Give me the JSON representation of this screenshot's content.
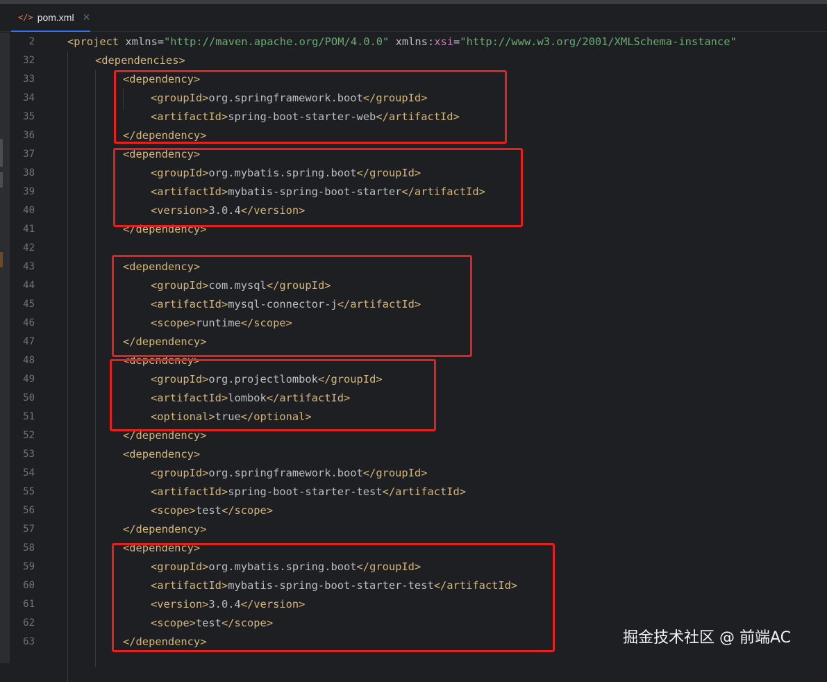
{
  "tab": {
    "icon": "</>",
    "label": "pom.xml",
    "close": "×"
  },
  "lines": [
    {
      "num": "2",
      "indent": 0,
      "parts": [
        [
          "tag",
          "<project "
        ],
        [
          "attr",
          "xmlns="
        ],
        [
          "str",
          "\"http://maven.apache.org/POM/4.0.0\""
        ],
        [
          "attr",
          " xmlns:"
        ],
        [
          "ns",
          "xsi"
        ],
        [
          "attr",
          "="
        ],
        [
          "str",
          "\"http://www.w3.org/2001/XMLSchema-instance\""
        ]
      ]
    },
    {
      "num": "32",
      "indent": 1,
      "parts": [
        [
          "tag",
          "<dependencies>"
        ]
      ]
    },
    {
      "num": "33",
      "indent": 2,
      "parts": [
        [
          "tag",
          "<dependency>"
        ]
      ]
    },
    {
      "num": "34",
      "indent": 3,
      "parts": [
        [
          "tag",
          "<groupId>"
        ],
        [
          "txt",
          "org.springframework.boot"
        ],
        [
          "tag",
          "</groupId>"
        ]
      ]
    },
    {
      "num": "35",
      "indent": 3,
      "parts": [
        [
          "tag",
          "<artifactId>"
        ],
        [
          "txt",
          "spring-boot-starter-web"
        ],
        [
          "tag",
          "</artifactId>"
        ]
      ]
    },
    {
      "num": "36",
      "indent": 2,
      "parts": [
        [
          "tag",
          "</dependency>"
        ]
      ]
    },
    {
      "num": "37",
      "indent": 2,
      "parts": [
        [
          "tag",
          "<dependency>"
        ]
      ]
    },
    {
      "num": "38",
      "indent": 3,
      "parts": [
        [
          "tag",
          "<groupId>"
        ],
        [
          "txt",
          "org.mybatis.spring.boot"
        ],
        [
          "tag",
          "</groupId>"
        ]
      ]
    },
    {
      "num": "39",
      "indent": 3,
      "parts": [
        [
          "tag",
          "<artifactId>"
        ],
        [
          "txt",
          "mybatis-spring-boot-starter"
        ],
        [
          "tag",
          "</artifactId>"
        ]
      ]
    },
    {
      "num": "40",
      "indent": 3,
      "parts": [
        [
          "tag",
          "<version>"
        ],
        [
          "txt",
          "3.0.4"
        ],
        [
          "tag",
          "</version>"
        ]
      ]
    },
    {
      "num": "41",
      "indent": 2,
      "parts": [
        [
          "tag",
          "</dependency>"
        ]
      ]
    },
    {
      "num": "42",
      "indent": 0,
      "parts": []
    },
    {
      "num": "43",
      "indent": 2,
      "parts": [
        [
          "tag",
          "<dependency>"
        ]
      ]
    },
    {
      "num": "44",
      "indent": 3,
      "parts": [
        [
          "tag",
          "<groupId>"
        ],
        [
          "txt",
          "com.mysql"
        ],
        [
          "tag",
          "</groupId>"
        ]
      ]
    },
    {
      "num": "45",
      "indent": 3,
      "parts": [
        [
          "tag",
          "<artifactId>"
        ],
        [
          "txt",
          "mysql-connector-j"
        ],
        [
          "tag",
          "</artifactId>"
        ]
      ]
    },
    {
      "num": "46",
      "indent": 3,
      "parts": [
        [
          "tag",
          "<scope>"
        ],
        [
          "txt",
          "runtime"
        ],
        [
          "tag",
          "</scope>"
        ]
      ]
    },
    {
      "num": "47",
      "indent": 2,
      "parts": [
        [
          "tag",
          "</dependency>"
        ]
      ]
    },
    {
      "num": "48",
      "indent": 2,
      "parts": [
        [
          "tag",
          "<dependency>"
        ]
      ]
    },
    {
      "num": "49",
      "indent": 3,
      "parts": [
        [
          "tag",
          "<groupId>"
        ],
        [
          "txt",
          "org.projectlombok"
        ],
        [
          "tag",
          "</groupId>"
        ]
      ]
    },
    {
      "num": "50",
      "indent": 3,
      "parts": [
        [
          "tag",
          "<artifactId>"
        ],
        [
          "txt",
          "lombok"
        ],
        [
          "tag",
          "</artifactId>"
        ]
      ]
    },
    {
      "num": "51",
      "indent": 3,
      "parts": [
        [
          "tag",
          "<optional>"
        ],
        [
          "txt",
          "true"
        ],
        [
          "tag",
          "</optional>"
        ]
      ]
    },
    {
      "num": "52",
      "indent": 2,
      "parts": [
        [
          "tag",
          "</dependency>"
        ]
      ]
    },
    {
      "num": "53",
      "indent": 2,
      "parts": [
        [
          "tag",
          "<dependency>"
        ]
      ]
    },
    {
      "num": "54",
      "indent": 3,
      "parts": [
        [
          "tag",
          "<groupId>"
        ],
        [
          "txt",
          "org.springframework.boot"
        ],
        [
          "tag",
          "</groupId>"
        ]
      ]
    },
    {
      "num": "55",
      "indent": 3,
      "parts": [
        [
          "tag",
          "<artifactId>"
        ],
        [
          "txt",
          "spring-boot-starter-test"
        ],
        [
          "tag",
          "</artifactId>"
        ]
      ]
    },
    {
      "num": "56",
      "indent": 3,
      "parts": [
        [
          "tag",
          "<scope>"
        ],
        [
          "txt",
          "test"
        ],
        [
          "tag",
          "</scope>"
        ]
      ]
    },
    {
      "num": "57",
      "indent": 2,
      "parts": [
        [
          "tag",
          "</dependency>"
        ]
      ]
    },
    {
      "num": "58",
      "indent": 2,
      "parts": [
        [
          "tag",
          "<dependency>"
        ]
      ]
    },
    {
      "num": "59",
      "indent": 3,
      "parts": [
        [
          "tag",
          "<groupId>"
        ],
        [
          "txt",
          "org.mybatis.spring.boot"
        ],
        [
          "tag",
          "</groupId>"
        ]
      ]
    },
    {
      "num": "60",
      "indent": 3,
      "parts": [
        [
          "tag",
          "<artifactId>"
        ],
        [
          "txt",
          "mybatis-spring-boot-starter-test"
        ],
        [
          "tag",
          "</artifactId>"
        ]
      ]
    },
    {
      "num": "61",
      "indent": 3,
      "parts": [
        [
          "tag",
          "<version>"
        ],
        [
          "txt",
          "3.0.4"
        ],
        [
          "tag",
          "</version>"
        ]
      ]
    },
    {
      "num": "62",
      "indent": 3,
      "parts": [
        [
          "tag",
          "<scope>"
        ],
        [
          "txt",
          "test"
        ],
        [
          "tag",
          "</scope>"
        ]
      ]
    },
    {
      "num": "63",
      "indent": 2,
      "parts": [
        [
          "tag",
          "</dependency>"
        ]
      ]
    }
  ],
  "colors": {
    "tag": "#d5b778",
    "text": "#bcbec4",
    "string": "#6aab73",
    "namespace": "#c77dbb",
    "highlight": "#e8201d",
    "background": "#1e1f22"
  },
  "watermark": "掘金技术社区 @ 前端AC"
}
